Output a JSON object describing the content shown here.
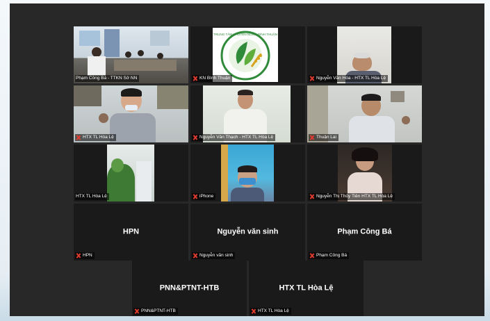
{
  "participants": [
    {
      "name": "Phạm Công Bá - TTKN Sở NN",
      "muted": false,
      "active_speaker": true
    },
    {
      "name": "KN Bình Thuận",
      "muted": true,
      "active_speaker": false,
      "logo_text": "TRUNG TÂM KHUYẾN NÔNG BÌNH THUẬN"
    },
    {
      "name": "Nguyễn Văn Hóa - HTX TL Hòa Lệ",
      "muted": true,
      "active_speaker": false
    },
    {
      "name": "HTX TL Hòa Lệ",
      "muted": true,
      "active_speaker": false
    },
    {
      "name": "Nguyễn Văn Thạch - HTX TL Hòa Lệ",
      "muted": true,
      "active_speaker": false
    },
    {
      "name": "Thuận Lai",
      "muted": true,
      "active_speaker": false
    },
    {
      "name": "HTX TL Hòa Lệ",
      "muted": false,
      "active_speaker": false
    },
    {
      "name": "iPhone",
      "muted": true,
      "active_speaker": false
    },
    {
      "name": "Nguyễn Thị Thủy Tiên HTX TL Hòa Lệ",
      "muted": true,
      "active_speaker": false
    },
    {
      "name": "HPN",
      "display": "HPN",
      "muted": true,
      "active_speaker": false
    },
    {
      "name": "Nguyễn văn sinh",
      "display": "Nguyễn văn sinh",
      "muted": true,
      "active_speaker": false
    },
    {
      "name": "Phạm Công Bá",
      "display": "Phạm Công Bá",
      "muted": true,
      "active_speaker": false
    },
    {
      "name": "PNN&PTNT-HTB",
      "display": "PNN&PTNT-HTB",
      "muted": true,
      "active_speaker": false
    },
    {
      "name": "HTX TL Hòa Lệ",
      "display": "HTX TL Hòa Lệ",
      "muted": true,
      "active_speaker": false
    }
  ],
  "colors": {
    "active_speaker_border": "#e6e600",
    "muted_icon": "#e23b2e",
    "background": "#282828"
  }
}
